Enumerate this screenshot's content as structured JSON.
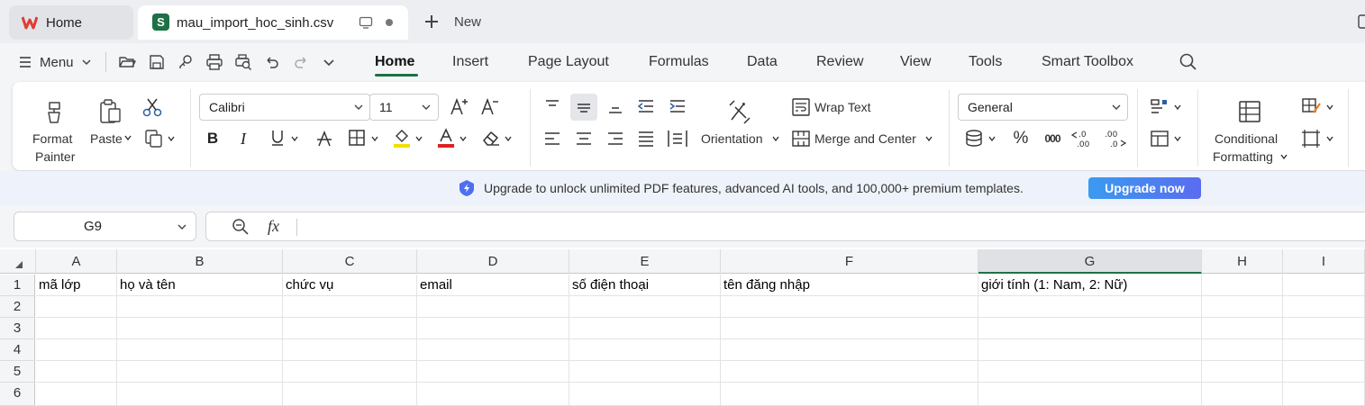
{
  "tabs": {
    "home": "Home",
    "file": "mau_import_hoc_sinh.csv",
    "file_icon": "S",
    "new": "New"
  },
  "menubar": {
    "menu": "Menu",
    "tabs": [
      "Home",
      "Insert",
      "Page Layout",
      "Formulas",
      "Data",
      "Review",
      "View",
      "Tools",
      "Smart Toolbox"
    ],
    "active": "Home"
  },
  "ribbon": {
    "format_painter_1": "Format",
    "format_painter_2": "Painter",
    "paste": "Paste",
    "font_name": "Calibri",
    "font_size": "11",
    "wrap_text": "Wrap Text",
    "orientation": "Orientation",
    "merge_center": "Merge and Center",
    "number_format": "General",
    "conditional_1": "Conditional",
    "conditional_2": "Formatting",
    "percent": "%",
    "thousands": "000",
    "dec_increase": "+.0 .00",
    "dec_decrease": ".00 +.0"
  },
  "banner": {
    "text": "Upgrade to unlock unlimited PDF features, advanced AI tools, and 100,000+ premium templates.",
    "button": "Upgrade now"
  },
  "formula_bar": {
    "cell_ref": "G9",
    "fx": "fx",
    "value": ""
  },
  "sheet": {
    "columns": [
      "A",
      "B",
      "C",
      "D",
      "E",
      "F",
      "G",
      "H",
      "I"
    ],
    "rows": [
      "1",
      "2",
      "3",
      "4",
      "5",
      "6"
    ],
    "headers": [
      "mã lớp",
      "họ và tên",
      "chức vụ",
      "email",
      "số điện thoại",
      "tên đăng nhập",
      "giới tính (1: Nam, 2: Nữ)",
      "",
      ""
    ],
    "selected_column": "G"
  },
  "colors": {
    "accent": "#1e7145",
    "banner_button": "#3b82f6",
    "wps_red": "#e03c31"
  }
}
